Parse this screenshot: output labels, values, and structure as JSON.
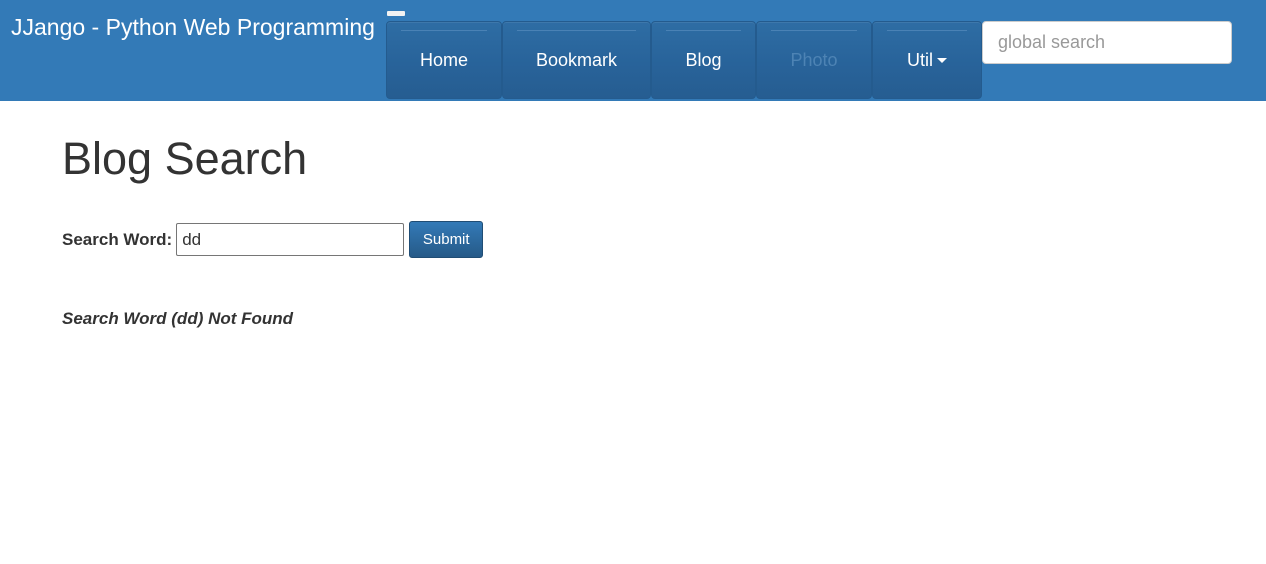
{
  "navbar": {
    "brand": "JJango - Python Web Programming",
    "items": [
      {
        "label": "Home",
        "disabled": false
      },
      {
        "label": "Bookmark",
        "disabled": false
      },
      {
        "label": "Blog",
        "disabled": false
      },
      {
        "label": "Photo",
        "disabled": true
      },
      {
        "label": "Util",
        "disabled": false,
        "dropdown": true
      }
    ],
    "search_placeholder": "global search",
    "accent_color": "#337ab7"
  },
  "main": {
    "title": "Blog Search",
    "form": {
      "label": "Search Word:",
      "value": "dd",
      "submit_label": "Submit"
    },
    "result_message": "Search Word (dd) Not Found"
  }
}
